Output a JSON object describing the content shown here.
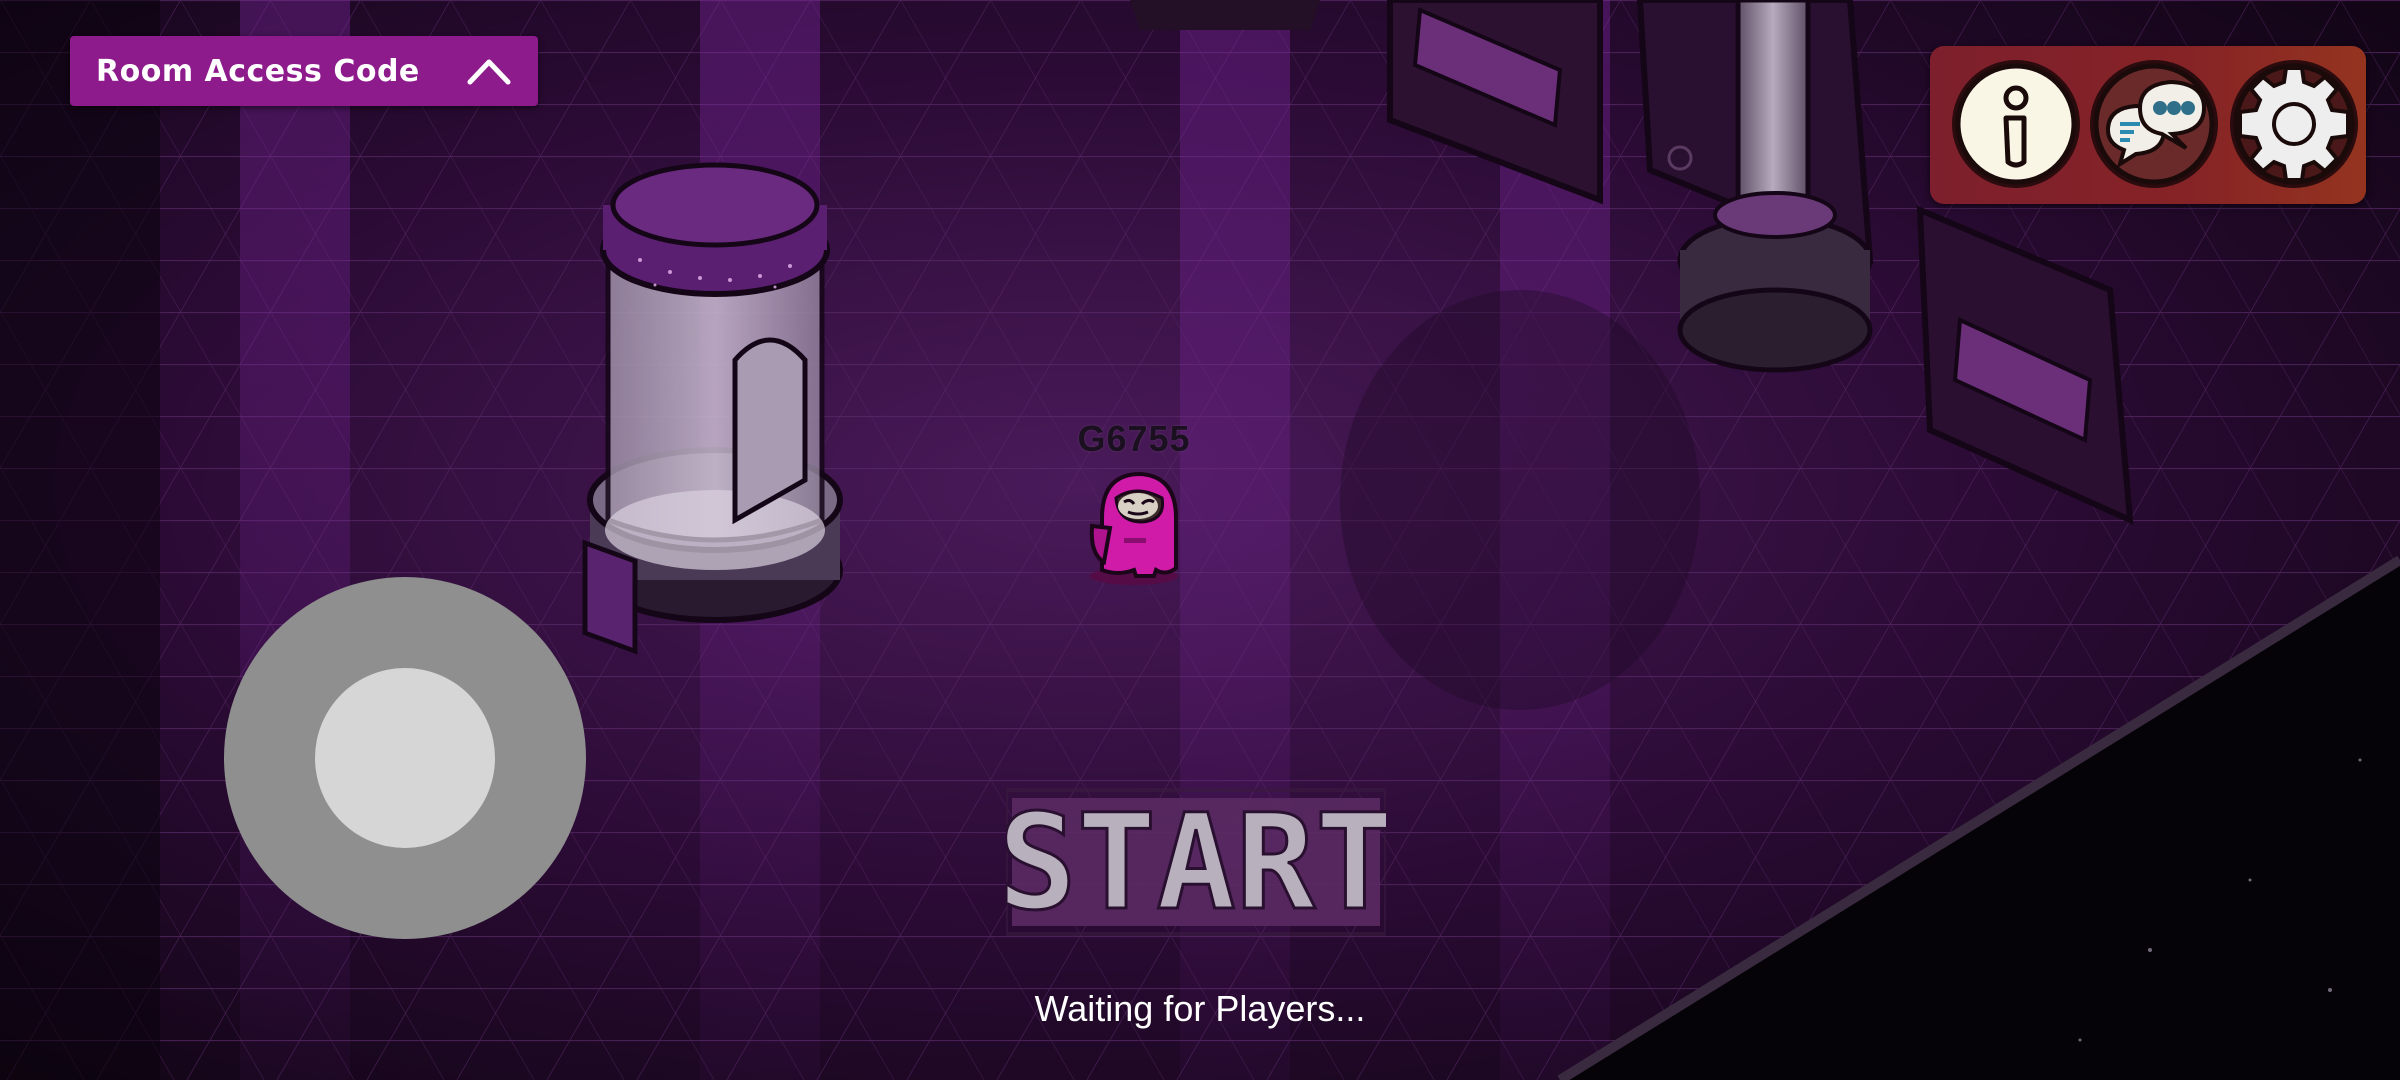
{
  "room_code_panel": {
    "label": "Room Access Code",
    "chevron_icon": "chevron-up-icon"
  },
  "top_buttons": {
    "info_icon": "info-icon",
    "chat_icon": "chat-icon",
    "settings_icon": "gear-icon"
  },
  "player": {
    "name": "G6755",
    "color": "#d01ba8"
  },
  "start_button": {
    "label": "START"
  },
  "status": {
    "text": "Waiting for Players..."
  },
  "colors": {
    "accent_purple": "#8e1b8c",
    "button_bar": "#862326",
    "floor": "#2c0a34"
  }
}
